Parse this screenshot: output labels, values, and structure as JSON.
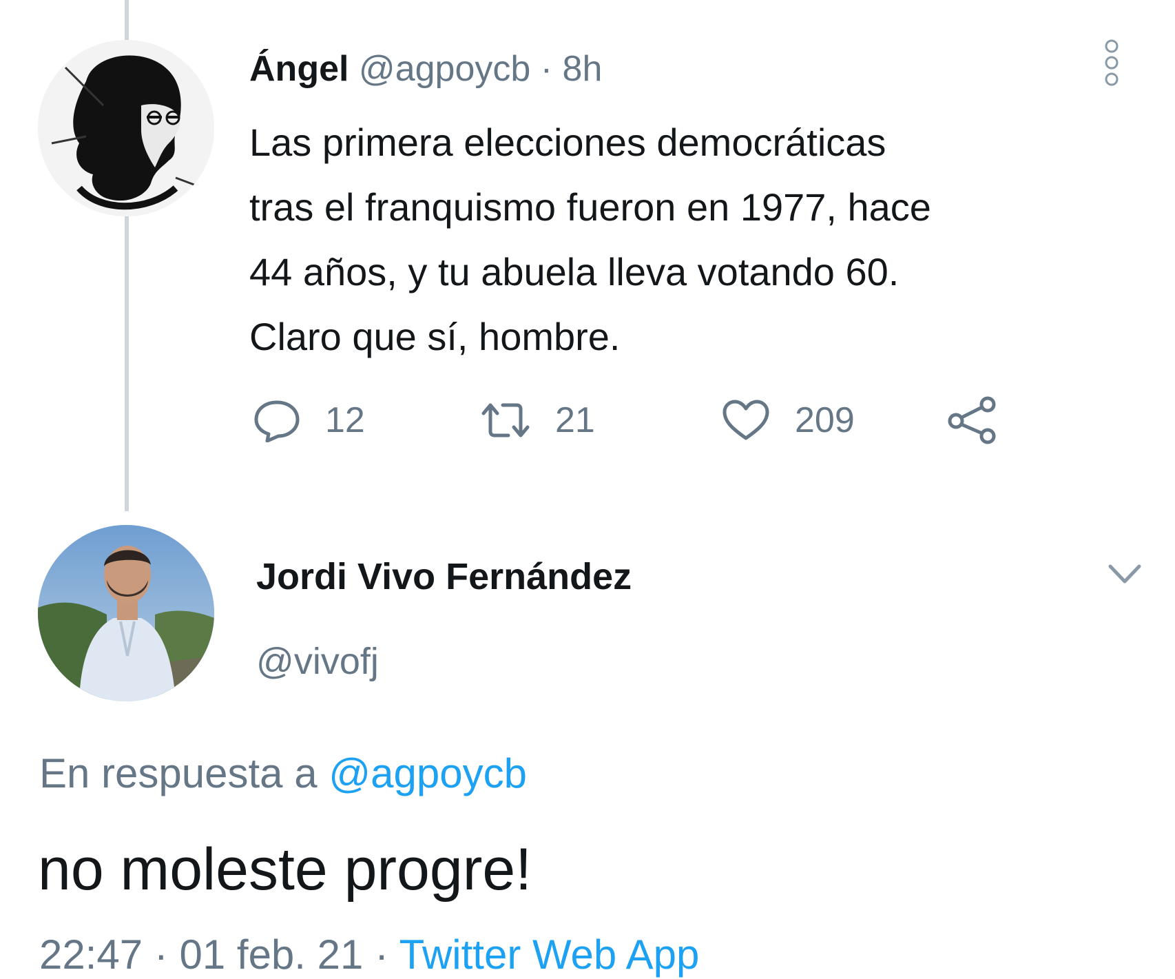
{
  "tweet1": {
    "author_name": "Ángel",
    "author_handle": "@agpoycb",
    "separator": "·",
    "time": "8h",
    "text_lines": [
      "Las primera elecciones democráticas",
      "tras el franquismo fueron en 1977, hace",
      "44 años, y tu abuela lleva votando 60.",
      "Claro que sí, hombre."
    ],
    "actions": {
      "reply_count": "12",
      "retweet_count": "21",
      "like_count": "209"
    },
    "icons": [
      "more-options-icon",
      "reply-icon",
      "retweet-icon",
      "like-icon",
      "share-icon"
    ]
  },
  "tweet2": {
    "author_name": "Jordi Vivo Fernández",
    "author_handle": "@vivofj",
    "reply_to_prefix": "En respuesta a",
    "reply_to_handle": "@agpoycb",
    "text": "no moleste progre!",
    "time": "22:47",
    "separator": "·",
    "date": "01 feb. 21",
    "source": "Twitter Web App",
    "icons": [
      "chevron-down-icon"
    ]
  },
  "colors": {
    "text": "#14171a",
    "secondary": "#657786",
    "link": "#1da1f2",
    "thread_line": "#cfd6db"
  }
}
